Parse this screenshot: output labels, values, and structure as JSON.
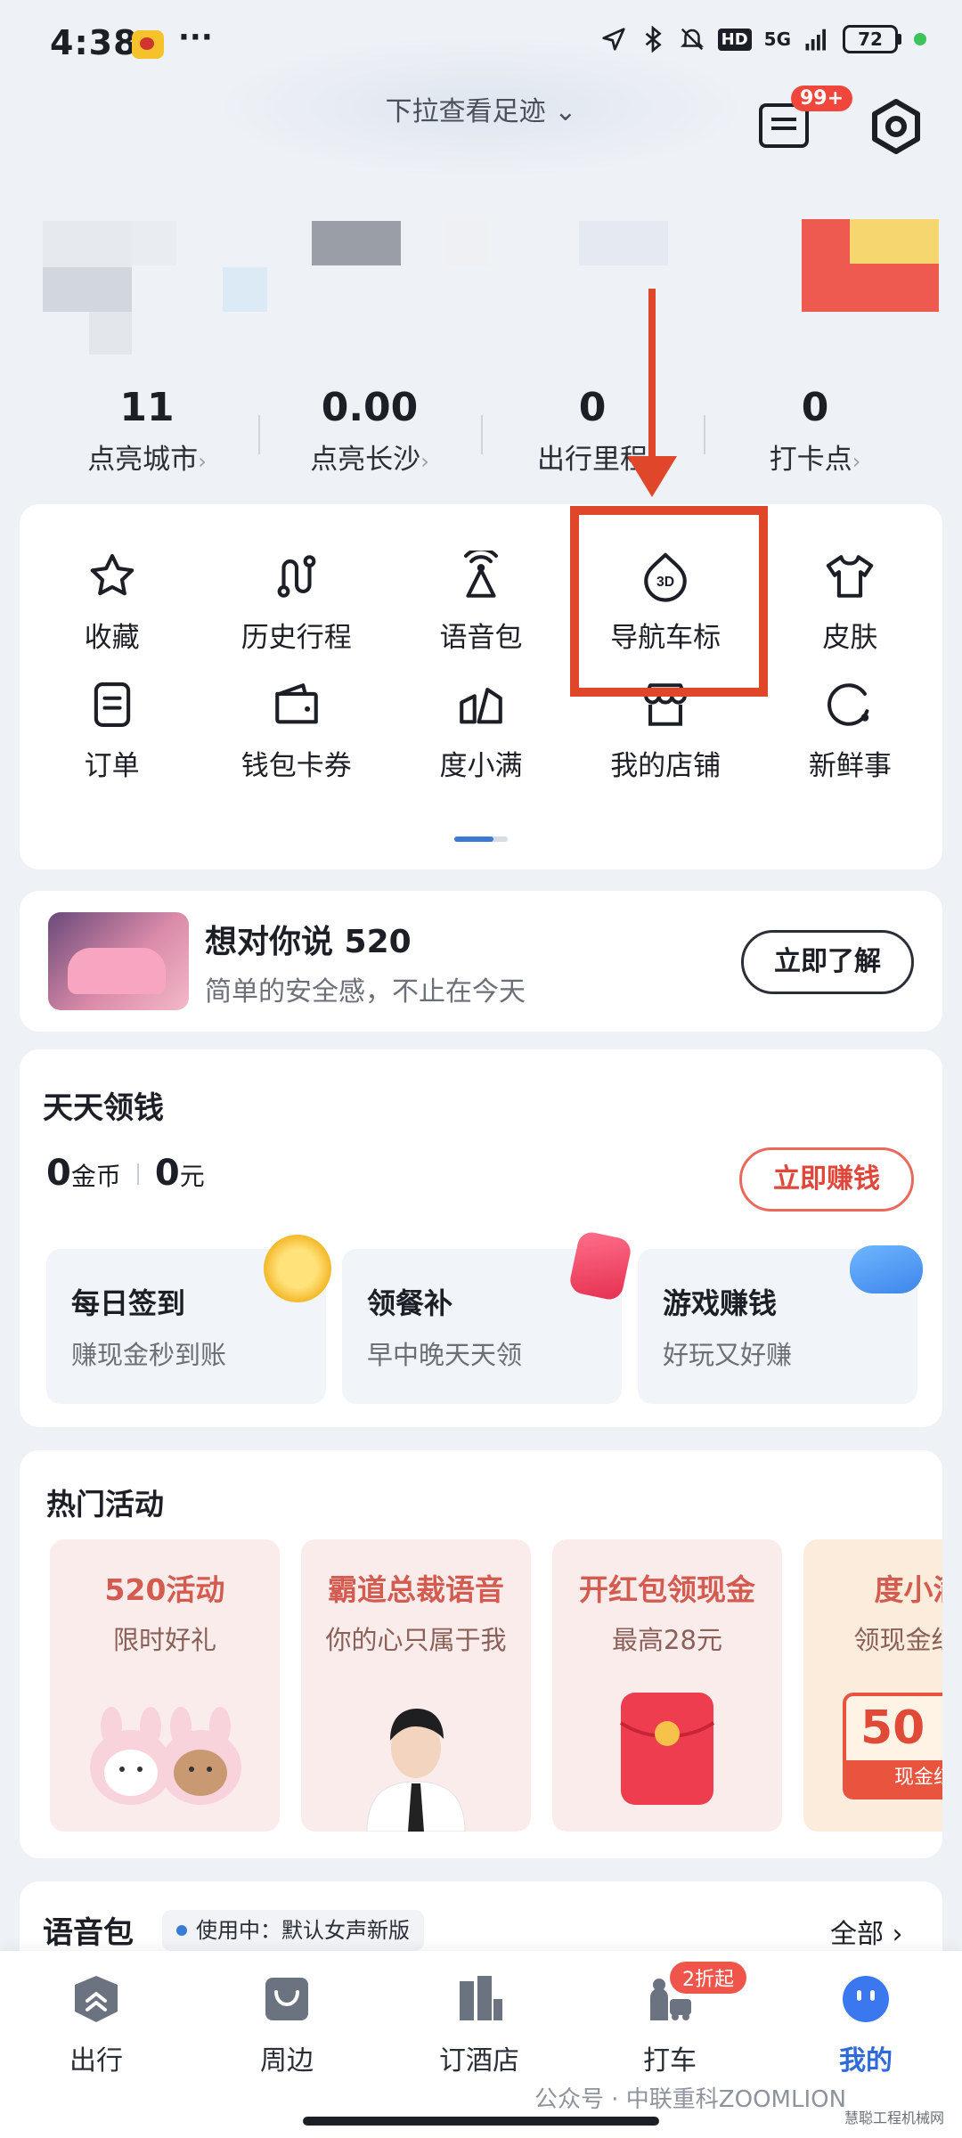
{
  "status_bar": {
    "time": "4:38",
    "more": "···",
    "network": "5G",
    "hd": "HD",
    "battery": "72"
  },
  "header": {
    "pull_hint": "下拉查看足迹",
    "message_badge": "99+"
  },
  "stats": [
    {
      "value": "11",
      "label": "点亮城市"
    },
    {
      "value": "0.00",
      "label": "点亮长沙"
    },
    {
      "value": "0",
      "label": "出行里程"
    },
    {
      "value": "0",
      "label": "打卡点"
    }
  ],
  "tools": [
    {
      "label": "收藏",
      "icon": "star-icon"
    },
    {
      "label": "历史行程",
      "icon": "route-icon"
    },
    {
      "label": "语音包",
      "icon": "voice-pack-icon"
    },
    {
      "label": "导航车标",
      "icon": "nav-car-logo-3d-icon",
      "badge": "3D"
    },
    {
      "label": "皮肤",
      "icon": "tshirt-icon"
    },
    {
      "label": "订单",
      "icon": "order-icon"
    },
    {
      "label": "钱包卡券",
      "icon": "wallet-icon"
    },
    {
      "label": "度小满",
      "icon": "duxiaoman-icon"
    },
    {
      "label": "我的店铺",
      "icon": "shop-icon"
    },
    {
      "label": "新鲜事",
      "icon": "news-icon"
    }
  ],
  "promo": {
    "title": "想对你说 520",
    "subtitle": "简单的安全感，不止在今天",
    "button": "立即了解"
  },
  "coins": {
    "title": "天天领钱",
    "coin_value": "0",
    "coin_unit": "金币",
    "cash_value": "0",
    "cash_unit": "元",
    "button": "立即赚钱",
    "tasks": [
      {
        "title": "每日签到",
        "subtitle": "赚现金秒到账"
      },
      {
        "title": "领餐补",
        "subtitle": "早中晚天天领"
      },
      {
        "title": "游戏赚钱",
        "subtitle": "好玩又好赚"
      }
    ]
  },
  "hot": {
    "title": "热门活动",
    "items": [
      {
        "title": "520活动",
        "subtitle": "限时好礼"
      },
      {
        "title": "霸道总裁语音",
        "subtitle": "你的心只属于我"
      },
      {
        "title": "开红包领现金",
        "subtitle": "最高28元"
      },
      {
        "title": "度小满",
        "subtitle": "领现金红包",
        "tag_value": "50",
        "tag_label": "现金红包"
      }
    ]
  },
  "voice": {
    "title": "语音包",
    "status": "使用中：默认女声新版",
    "all": "全部 ›"
  },
  "bottom_nav": {
    "items": [
      {
        "label": "出行"
      },
      {
        "label": "周边"
      },
      {
        "label": "订酒店"
      },
      {
        "label": "打车"
      },
      {
        "label": "我的"
      }
    ],
    "taxi_badge": "2折起"
  },
  "watermark": "公众号 · 中联重科ZOOMLION",
  "watermark_site": "慧聪工程机械网"
}
